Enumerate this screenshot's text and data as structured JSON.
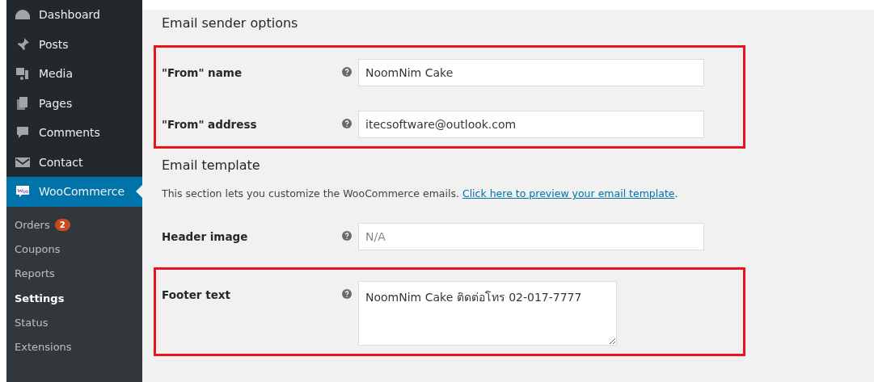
{
  "sidebar": {
    "items": [
      {
        "label": "Dashboard",
        "selected": false
      },
      {
        "label": "Posts",
        "selected": false
      },
      {
        "label": "Media",
        "selected": false
      },
      {
        "label": "Pages",
        "selected": false
      },
      {
        "label": "Comments",
        "selected": false
      },
      {
        "label": "Contact",
        "selected": false
      },
      {
        "label": "WooCommerce",
        "selected": true
      }
    ],
    "submenu": [
      {
        "label": "Orders",
        "badge": "2",
        "selected": false
      },
      {
        "label": "Coupons",
        "selected": false
      },
      {
        "label": "Reports",
        "selected": false
      },
      {
        "label": "Settings",
        "selected": true
      },
      {
        "label": "Status",
        "selected": false
      },
      {
        "label": "Extensions",
        "selected": false
      }
    ]
  },
  "sections": [
    {
      "title": "Email sender options",
      "groups": [
        {
          "highlighted": true,
          "fields": [
            {
              "label": "\"From\" name",
              "kind": "input",
              "value": "NoomNim Cake"
            },
            {
              "label": "\"From\" address",
              "kind": "input",
              "value": "itecsoftware@outlook.com"
            }
          ]
        }
      ]
    },
    {
      "title": "Email template",
      "description": "This section lets you customize the WooCommerce emails. ",
      "link": "Click here to preview your email template",
      "after_link": ".",
      "groups": [
        {
          "highlighted": false,
          "fields": [
            {
              "label": "Header image",
              "kind": "input",
              "placeholder": "N/A"
            }
          ]
        },
        {
          "highlighted": true,
          "fields": [
            {
              "label": "Footer text",
              "kind": "textarea",
              "value": "NoomNim Cake ติดต่อโทร 02-017-7777"
            }
          ]
        }
      ]
    }
  ]
}
